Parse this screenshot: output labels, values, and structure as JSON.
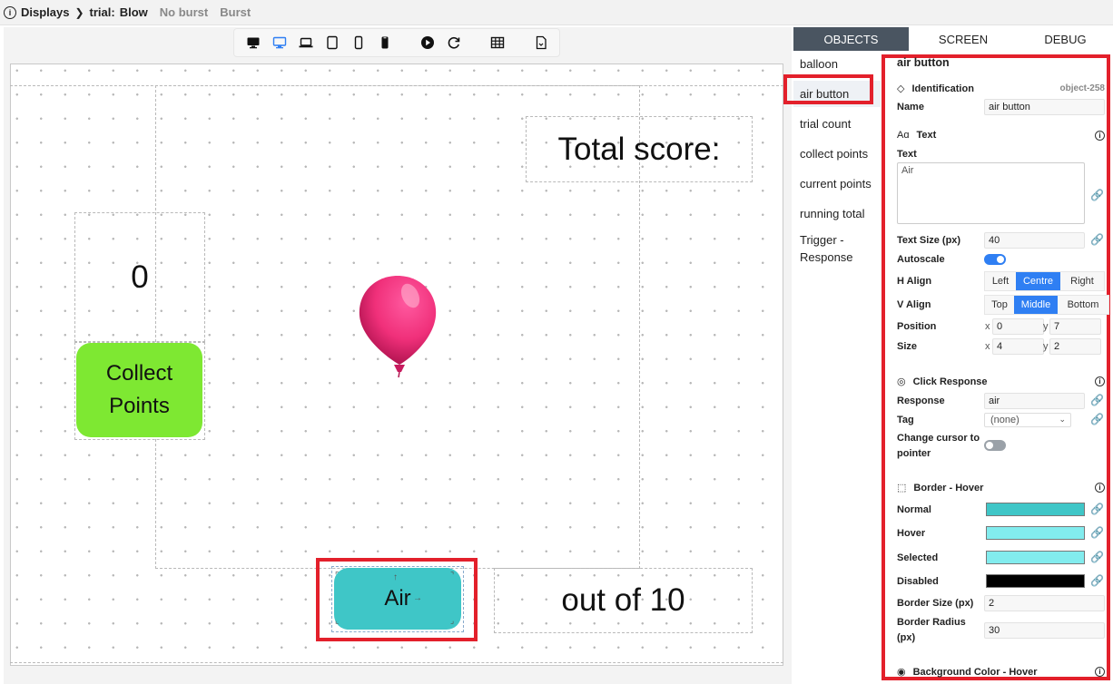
{
  "breadcrumb": {
    "root": "Displays",
    "trial_label": "trial:",
    "current": "Blow",
    "others": [
      "No burst",
      "Burst"
    ]
  },
  "toolbar": {
    "icons": [
      "desktop-icon",
      "desktop-active-icon",
      "laptop-icon",
      "tablet-icon",
      "phone-icon",
      "phone-dark-icon",
      "play-icon",
      "refresh-icon",
      "grid-icon",
      "export-icon"
    ]
  },
  "stage": {
    "total_score_label": "Total score:",
    "points_value": "0",
    "collect_label_1": "Collect",
    "collect_label_2": "Points",
    "air_label": "Air",
    "out_of_label": "out of 10",
    "collect_color": "#7ee832",
    "air_color": "#3fc6c7",
    "balloon_color": "#f0307a"
  },
  "tabs": [
    "OBJECTS",
    "SCREEN",
    "DEBUG"
  ],
  "objects": [
    "balloon",
    "air button",
    "trial count",
    "collect points",
    "current points",
    "running total",
    "Trigger - Response"
  ],
  "panel": {
    "title": "air button",
    "identification": {
      "heading": "Identification",
      "object_id": "object-258",
      "name_label": "Name",
      "name_value": "air button"
    },
    "text": {
      "heading": "Text",
      "text_label": "Text",
      "text_value": "Air",
      "size_label": "Text Size (px)",
      "size_value": "40",
      "autoscale_label": "Autoscale",
      "halign_label": "H Align",
      "halign_options": [
        "Left",
        "Centre",
        "Right"
      ],
      "halign_selected": "Centre",
      "valign_label": "V Align",
      "valign_options": [
        "Top",
        "Middle",
        "Bottom"
      ],
      "valign_selected": "Middle",
      "position_label": "Position",
      "position_x": "0",
      "position_y": "7",
      "size_label2": "Size",
      "size_x": "4",
      "size_y": "2",
      "x_label": "x",
      "y_label": "y"
    },
    "click": {
      "heading": "Click Response",
      "response_label": "Response",
      "response_value": "air",
      "tag_label": "Tag",
      "tag_value": "(none)",
      "cursor_label_1": "Change cursor to",
      "cursor_label_2": "pointer"
    },
    "border": {
      "heading": "Border - Hover",
      "normal_label": "Normal",
      "normal_color": "#3fc6c7",
      "hover_label": "Hover",
      "hover_color": "#82ecee",
      "selected_label": "Selected",
      "selected_color": "#82ecee",
      "disabled_label": "Disabled",
      "disabled_color": "#000000",
      "size_label": "Border Size (px)",
      "size_value": "2",
      "radius_label_1": "Border Radius",
      "radius_label_2": "(px)",
      "radius_value": "30"
    },
    "bg_heading": "Background Color - Hover"
  }
}
